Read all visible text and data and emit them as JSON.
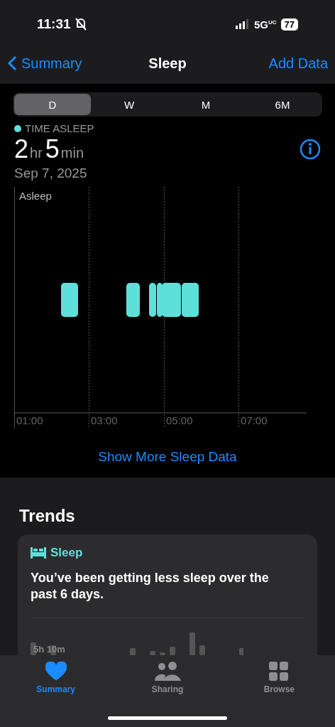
{
  "status_bar": {
    "time": "11:31",
    "network": "5G",
    "network_suffix": "UC",
    "battery": "77"
  },
  "nav": {
    "back": "Summary",
    "title": "Sleep",
    "action": "Add Data"
  },
  "segments": [
    {
      "label": "D",
      "selected": true
    },
    {
      "label": "W",
      "selected": false
    },
    {
      "label": "M",
      "selected": false
    },
    {
      "label": "6M",
      "selected": false
    }
  ],
  "summary": {
    "label": "TIME ASLEEP",
    "color": "#5ee0da",
    "hours": "2",
    "hours_unit": "hr",
    "minutes": "5",
    "minutes_unit": "min",
    "date": "Sep 7, 2025"
  },
  "sleep_chart": {
    "category": "Asleep",
    "ticks": [
      "01:00",
      "03:00",
      "05:00",
      "07:00"
    ]
  },
  "more_link": "Show More Sleep Data",
  "trends": {
    "title": "Trends",
    "card": {
      "category": "Sleep",
      "message": "You’ve been getting less sleep over the past 6 days.",
      "average": "5h 10m"
    }
  },
  "tab_bar": [
    {
      "label": "Summary",
      "kind": "heart",
      "selected": true
    },
    {
      "label": "Sharing",
      "kind": "people",
      "selected": false
    },
    {
      "label": "Browse",
      "kind": "grid",
      "selected": false
    }
  ]
}
